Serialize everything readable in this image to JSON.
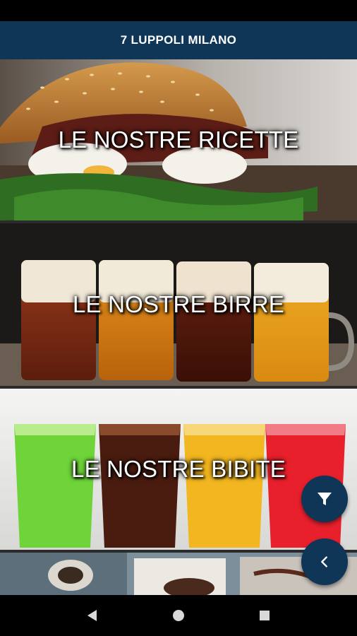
{
  "app": {
    "title": "7 LUPPOLI MILANO"
  },
  "tiles": [
    {
      "label": "LE NOSTRE RICETTE"
    },
    {
      "label": "LE NOSTRE BIRRE"
    },
    {
      "label": "LE NOSTRE BIBITE"
    }
  ],
  "fabs": {
    "filter_icon": "funnel-icon",
    "back_icon": "chevron-left-icon"
  },
  "navigation": {
    "back": "triangle-back-icon",
    "home": "circle-home-icon",
    "recents": "square-recents-icon"
  },
  "colors": {
    "primary": "#0f3557",
    "label_text": "#ffffff"
  }
}
